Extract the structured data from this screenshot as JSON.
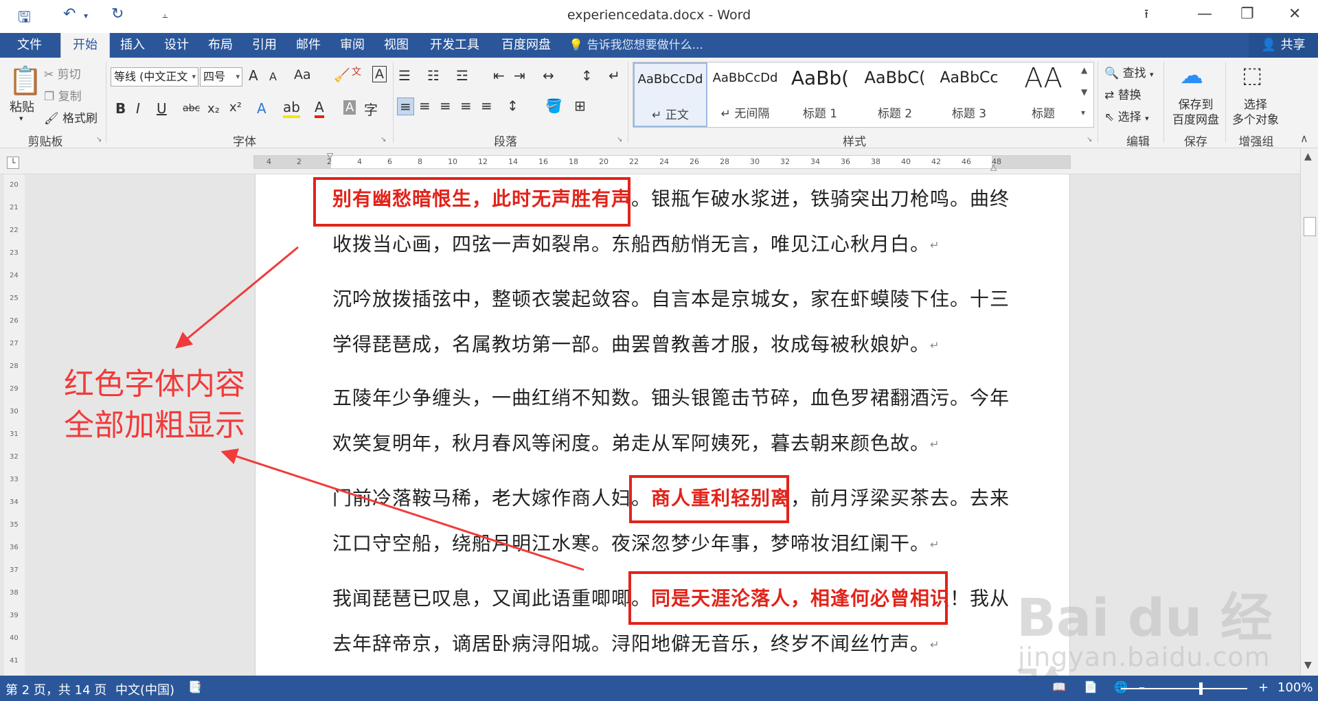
{
  "window": {
    "title": "experiencedata.docx - Word",
    "quick_access": [
      "save-icon",
      "undo-icon",
      "redo-icon",
      "customize-icon"
    ]
  },
  "tabs": {
    "file": "文件",
    "items": [
      "开始",
      "插入",
      "设计",
      "布局",
      "引用",
      "邮件",
      "审阅",
      "视图",
      "开发工具",
      "百度网盘"
    ],
    "active": "开始",
    "tell_me": "告诉我您想要做什么...",
    "share": "共享"
  },
  "ribbon": {
    "clipboard": {
      "label": "剪贴板",
      "paste": "粘贴",
      "cut": "剪切",
      "copy": "复制",
      "format_painter": "格式刷"
    },
    "font": {
      "label": "字体",
      "font_name": "等线 (中文正文",
      "font_size": "四号",
      "bold": "B",
      "italic": "I",
      "underline": "U",
      "strike": "abc",
      "subscript": "x₂",
      "superscript": "x²",
      "grow": "A",
      "shrink": "A",
      "change_case": "Aa"
    },
    "paragraph": {
      "label": "段落"
    },
    "styles": {
      "label": "样式",
      "items": [
        {
          "sample": "AaBbCcDd",
          "name": "↵ 正文"
        },
        {
          "sample": "AaBbCcDd",
          "name": "↵ 无间隔"
        },
        {
          "sample": "AaBb(",
          "name": "标题 1"
        },
        {
          "sample": "AaBbC(",
          "name": "标题 2"
        },
        {
          "sample": "AaBbCc",
          "name": "标题 3"
        },
        {
          "sample": "AA",
          "name": "标题"
        }
      ]
    },
    "editing": {
      "label": "编辑",
      "find": "查找",
      "replace": "替换",
      "select": "选择"
    },
    "save_group": {
      "label": "保存",
      "button": "保存到\n百度网盘",
      "line1": "保存到",
      "line2": "百度网盘"
    },
    "enhance": {
      "label": "增强组",
      "line1": "选择",
      "line2": "多个对象"
    }
  },
  "ruler": {
    "marks": [
      "4",
      "2",
      "2",
      "4",
      "6",
      "8",
      "10",
      "12",
      "14",
      "16",
      "18",
      "20",
      "22",
      "24",
      "26",
      "28",
      "30",
      "32",
      "34",
      "36",
      "38",
      "40",
      "42",
      "46",
      "48"
    ],
    "vertical_marks": [
      "20",
      "21",
      "22",
      "23",
      "24",
      "25",
      "26",
      "27",
      "28",
      "29",
      "30",
      "31",
      "32",
      "33",
      "34",
      "35",
      "36",
      "37",
      "38",
      "39",
      "40",
      "41"
    ]
  },
  "document": {
    "paragraphs": [
      {
        "line1": [
          {
            "text": "别有幽愁暗恨生，此时无声胜有声",
            "red": true
          },
          {
            "text": "。银瓶乍破水浆迸，铁骑突出刀枪鸣。曲终",
            "red": false
          }
        ],
        "line2": "收拨当心画，四弦一声如裂帛。东船西舫悄无言，唯见江心秋月白。"
      },
      {
        "line1": [
          {
            "text": "沉吟放拨插弦中，整顿衣裳起敛容。自言本是京城女，家在虾蟆陵下住。十三",
            "red": false
          }
        ],
        "line2": "学得琵琶成，名属教坊第一部。曲罢曾教善才服，妆成每被秋娘妒。"
      },
      {
        "line1": [
          {
            "text": "五陵年少争缠头，一曲红绡不知数。钿头银篦击节碎，血色罗裙翻酒污。今年",
            "red": false
          }
        ],
        "line2": "欢笑复明年，秋月春风等闲度。弟走从军阿姨死，暮去朝来颜色故。"
      },
      {
        "line1": [
          {
            "text": "门前冷落鞍马稀，老大嫁作商人妇。",
            "red": false
          },
          {
            "text": "商人重利轻别离",
            "red": true
          },
          {
            "text": "，前月浮梁买茶去。去来",
            "red": false
          }
        ],
        "line2": "江口守空船，绕船月明江水寒。夜深忽梦少年事，梦啼妆泪红阑干。"
      },
      {
        "line1": [
          {
            "text": "我闻琵琶已叹息，又闻此语重唧唧。",
            "red": false
          },
          {
            "text": "同是天涯沦落人，相逢何必曾相识",
            "red": true
          },
          {
            "text": "！我从",
            "red": false
          }
        ],
        "line2": "去年辞帝京，谪居卧病浔阳城。浔阳地僻无音乐，终岁不闻丝竹声。"
      }
    ],
    "paragraph_mark": "↵"
  },
  "annotation": {
    "line1": "红色字体内容",
    "line2": "全部加粗显示",
    "color": "#f13a3a"
  },
  "status": {
    "page": "第 2 页，共 14 页",
    "language": "中文(中国)",
    "zoom": "100%",
    "zoom_fraction": 0.63
  },
  "watermark": {
    "main": "Bai du 经验",
    "sub": "jingyan.baidu.com"
  },
  "colors": {
    "accent": "#2b579a",
    "highlight_red": "#e2231a"
  }
}
